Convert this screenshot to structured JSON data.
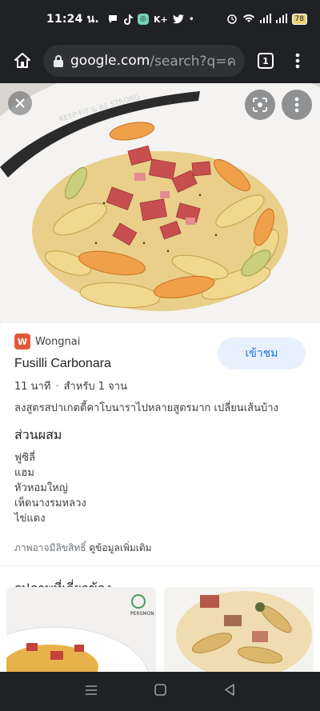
{
  "status_bar": {
    "time": "11:24 น.",
    "app_icons": [
      "message-icon",
      "tiktok-icon",
      "chatgpt-icon",
      "kplus-icon",
      "twitter-icon"
    ],
    "dot": "•",
    "battery": "78"
  },
  "browser": {
    "url_domain": "google.com",
    "url_rest": "/search?q=ค",
    "tab_count": "1"
  },
  "result": {
    "source": "Wongnai",
    "source_logo_letter": "W",
    "visit_label": "เข้าชม",
    "title": "Fusilli Carbonara",
    "time": "11 นาที",
    "separator": "·",
    "servings": "สำหรับ 1 จาน",
    "description": "ลงสูตรสปาเกตตี้คาโบนาราไปหลายสูตรมาก เปลี่ยนเส้นบ้าง",
    "ingredients_heading": "ส่วนผสม",
    "ingredients": [
      "ฟูซิลี่",
      "แฮม",
      "หัวหอมใหญ่",
      "เห็ดนางรมหลวง",
      "ไข่แดง"
    ],
    "copyright_text": "ภาพอาจมีลิขสิทธิ์",
    "more_info": "ดูข้อมูลเพิ่มเติม"
  },
  "related": {
    "heading": "รูปภาพที่เกี่ยวข้อง",
    "thumb_1_watermark": "PERSMON"
  },
  "hero": {
    "plate_text": "KEEP FIT & BE STRONG"
  },
  "colors": {
    "accent": "#1a73e8",
    "visit_bg": "#e8f0fe",
    "wongnai": "#e2593a",
    "chrome_bg": "#202124"
  }
}
